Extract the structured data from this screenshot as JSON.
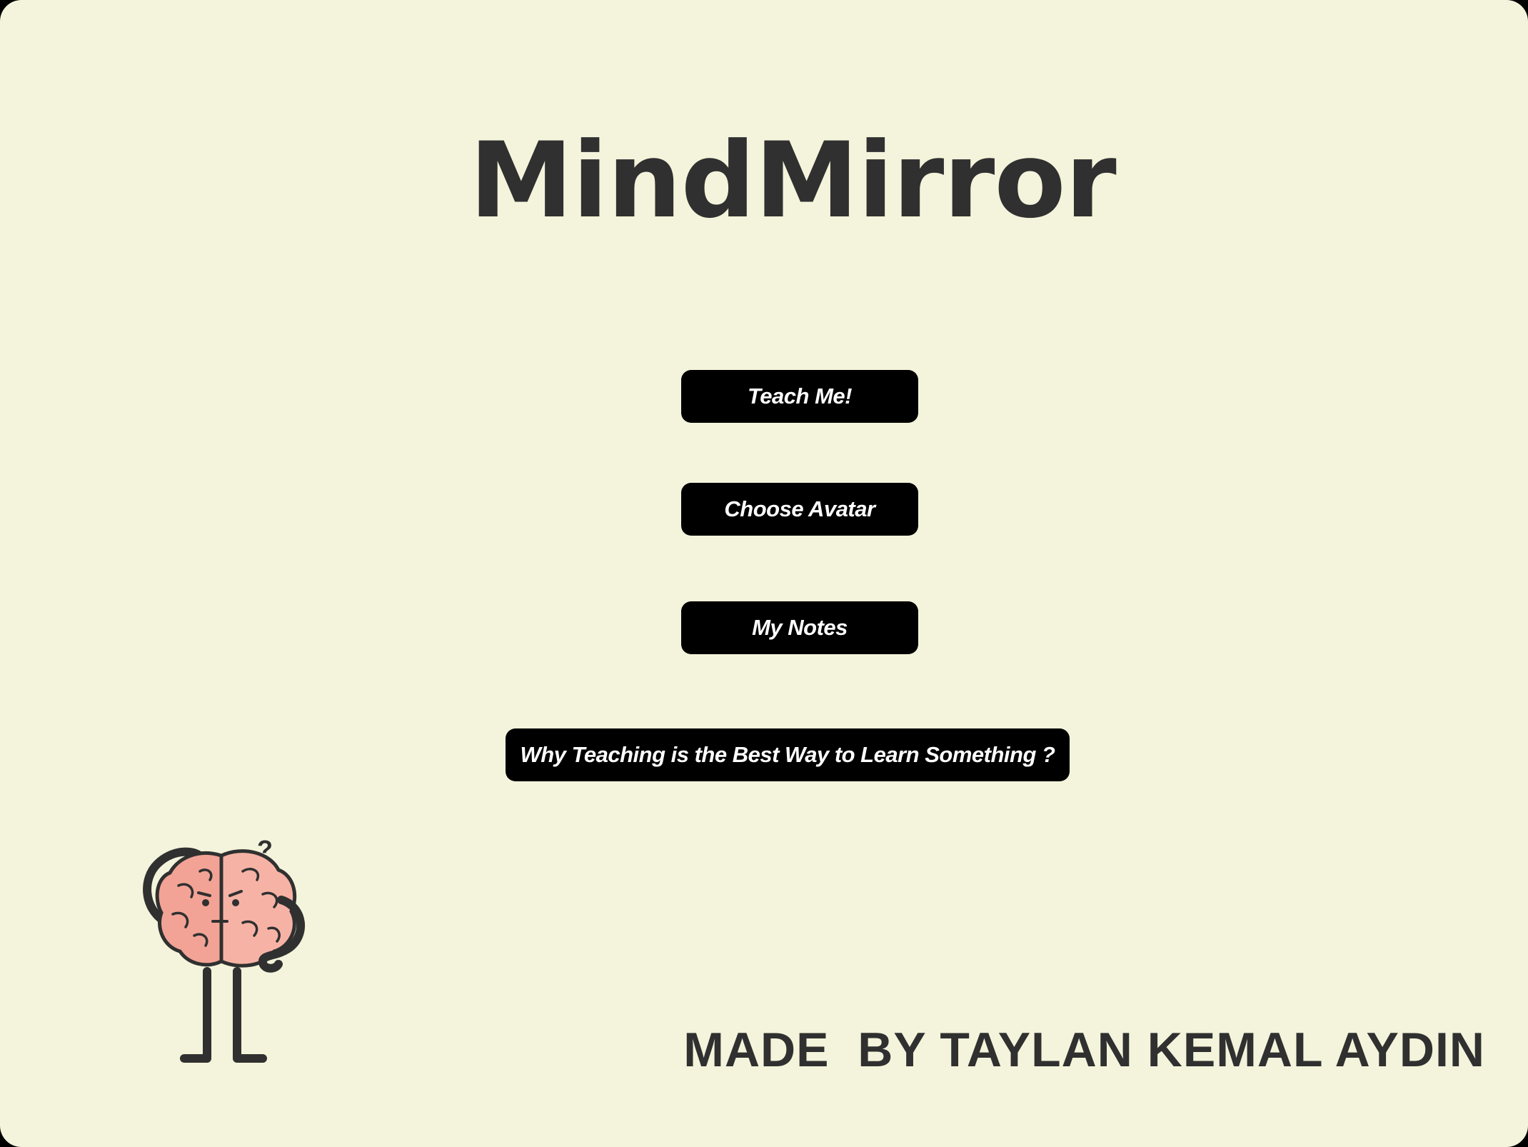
{
  "app": {
    "title": "MindMirror"
  },
  "menu": {
    "teach_label": "Teach Me!",
    "avatar_label": "Choose Avatar",
    "notes_label": "My Notes",
    "why_label": "Why Teaching is the Best Way to Learn Something ?"
  },
  "footer": {
    "credit": "MADE  BY TAYLAN KEMAL AYDIN"
  },
  "mascot": {
    "icon": "thinking-brain-icon",
    "symbol": "?"
  },
  "colors": {
    "background": "#f4f4dc",
    "title_text": "#303030",
    "button_bg": "#000000",
    "button_text": "#ffffff",
    "brain_pink": "#f2a395"
  }
}
